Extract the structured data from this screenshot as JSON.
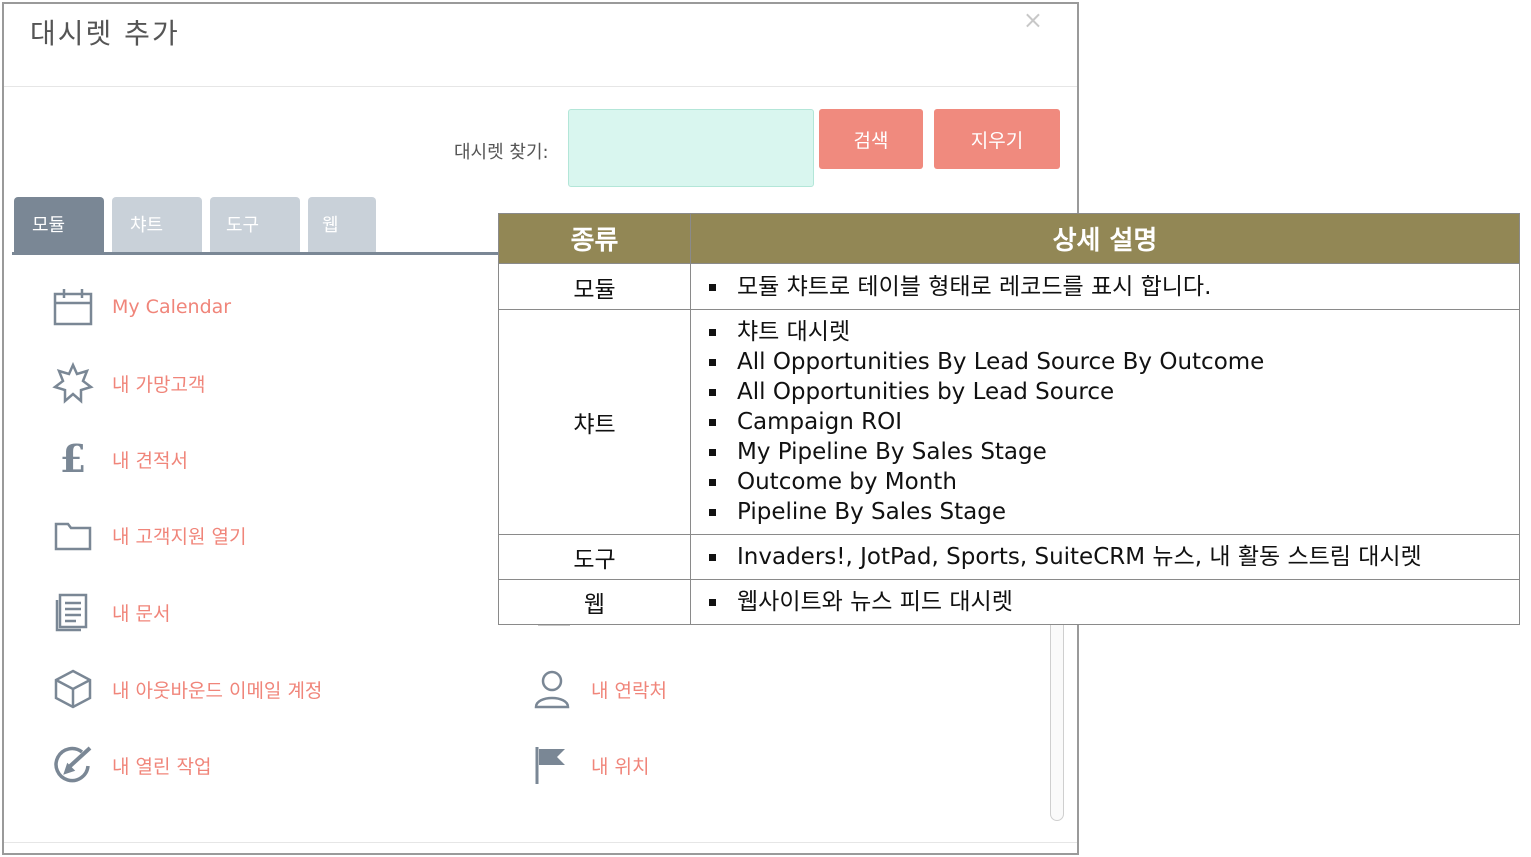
{
  "dialog": {
    "title": "대시렛 추가",
    "close_glyph": "×",
    "search": {
      "label": "대시렛 찾기:",
      "value": "",
      "placeholder": ""
    },
    "buttons": {
      "search": "검색",
      "clear": "지우기"
    },
    "tabs": [
      {
        "label": "모듈",
        "active": true
      },
      {
        "label": "챠트",
        "active": false
      },
      {
        "label": "도구",
        "active": false
      },
      {
        "label": "웹",
        "active": false
      }
    ],
    "items_left": [
      {
        "label": "My Calendar",
        "icon": "calendar-icon"
      },
      {
        "label": "내 가망고객",
        "icon": "star-burst-icon"
      },
      {
        "label": "내 견적서",
        "icon": "pound-icon"
      },
      {
        "label": "내 고객지원 열기",
        "icon": "folder-icon"
      },
      {
        "label": "내 문서",
        "icon": "document-icon"
      },
      {
        "label": "내 아웃바운드 이메일 계정",
        "icon": "cube-icon"
      },
      {
        "label": "내 열린 작업",
        "icon": "task-edit-icon"
      }
    ],
    "items_right": [
      {
        "label": "내 연락처",
        "icon": "person-icon"
      },
      {
        "label": "내 위치",
        "icon": "flag-icon"
      }
    ],
    "accent_color": "#f08a7e",
    "tab_active_color": "#7a8795",
    "tab_inactive_color": "#c9d1d9"
  },
  "table": {
    "header": {
      "type": "종류",
      "desc": "상세 설명"
    },
    "header_color": "#928755",
    "rows": [
      {
        "type": "모듈",
        "items": [
          "모듈 챠트로 테이블 형태로 레코드를 표시 합니다."
        ]
      },
      {
        "type": "챠트",
        "items": [
          "챠트 대시렛",
          "All Opportunities By Lead Source By Outcome",
          "All Opportunities by Lead Source",
          "Campaign ROI",
          "My Pipeline By Sales Stage",
          "Outcome by Month",
          "Pipeline By Sales Stage"
        ]
      },
      {
        "type": "도구",
        "items": [
          "Invaders!, JotPad, Sports, SuiteCRM 뉴스, 내 활동 스트림 대시렛"
        ]
      },
      {
        "type": "웹",
        "items": [
          "웹사이트와 뉴스 피드 대시렛"
        ]
      }
    ]
  }
}
